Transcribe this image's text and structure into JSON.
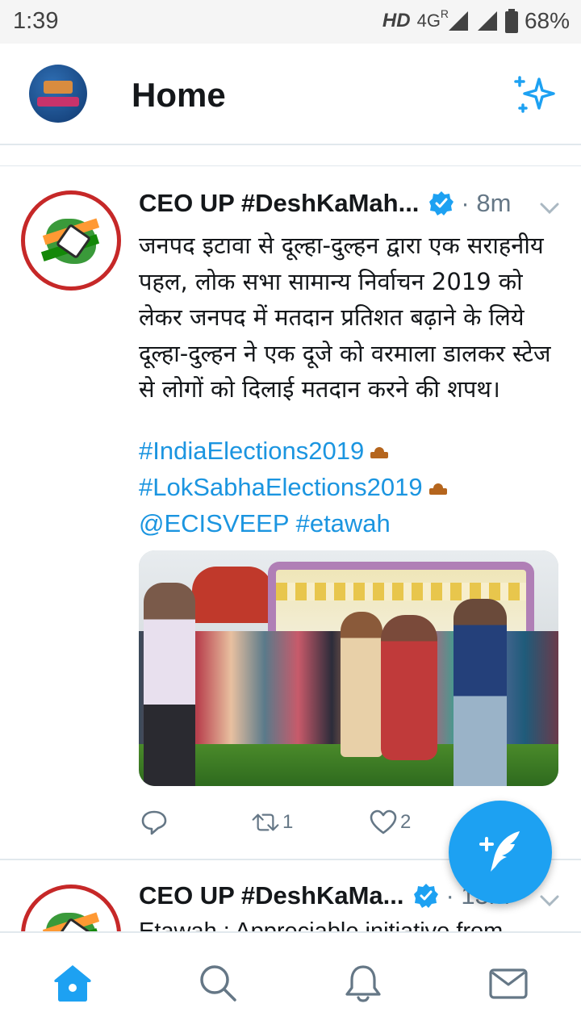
{
  "status_bar": {
    "time": "1:39",
    "network_hd": "HD",
    "network_type": "4G",
    "roaming": "R",
    "battery": "68%"
  },
  "header": {
    "title": "Home",
    "sparkle_icon": "sparkle-icon"
  },
  "tweets": [
    {
      "author": "CEO UP #DeshKaMah...",
      "time": "· 8m",
      "verified": true,
      "text": "जनपद इटावा से दूल्हा-दुल्हन द्वारा एक सराहनीय पहल, लोक सभा सामान्य निर्वाचन 2019 को लेकर जनपद में मतदान प्रतिशत बढ़ाने के लिये दूल्हा-दुल्हन ने एक दूजे को वरमाला डालकर स्टेज से लोगों को दिलाई मतदान करने की शपथ।",
      "hashtags": [
        "#IndiaElections2019",
        "#LokSabhaElections2019",
        "@ECISVEEP #etawah"
      ],
      "actions": {
        "reply_count": "",
        "retweet_count": "1",
        "like_count": "2"
      }
    },
    {
      "author": "CEO UP #DeshKaMa...",
      "time": "· 13m",
      "verified": true,
      "text": "Etawah : Appreciable initiative from"
    }
  ],
  "bottom_nav": {
    "items": [
      "home-icon",
      "search-icon",
      "notifications-icon",
      "messages-icon"
    ],
    "active": "home-icon"
  },
  "colors": {
    "accent": "#1da1f2",
    "link": "#1b95e0",
    "text": "#14171a",
    "muted": "#657786"
  }
}
